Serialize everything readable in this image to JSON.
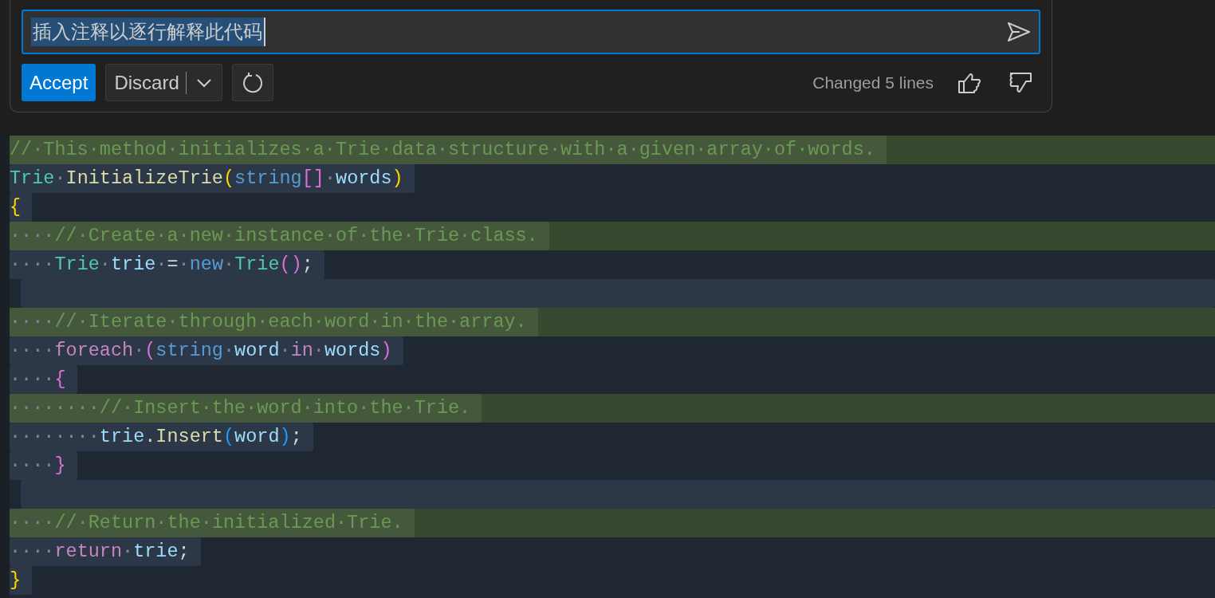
{
  "prompt": {
    "value": "插入注释以逐行解释此代码",
    "text_selected": true
  },
  "actions": {
    "accept": "Accept",
    "discard": "Discard",
    "status": "Changed 5 lines"
  },
  "code_lines": [
    {
      "added": true,
      "tokens": [
        {
          "t": "//·This·method·initializes·a·Trie·data·structure·with·a·given·array·of·words.",
          "kind": "comment"
        }
      ]
    },
    {
      "added": false,
      "tokens": [
        {
          "t": "Trie",
          "kind": "type"
        },
        {
          "t": "·",
          "kind": "ws"
        },
        {
          "t": "InitializeTrie",
          "kind": "method"
        },
        {
          "t": "(",
          "kind": "bracket1"
        },
        {
          "t": "string",
          "kind": "keyword"
        },
        {
          "t": "[]",
          "kind": "bracket2"
        },
        {
          "t": "·",
          "kind": "ws"
        },
        {
          "t": "words",
          "kind": "variable"
        },
        {
          "t": ")",
          "kind": "bracket1"
        }
      ]
    },
    {
      "added": false,
      "tokens": [
        {
          "t": "{",
          "kind": "bracket1"
        }
      ]
    },
    {
      "added": true,
      "tokens": [
        {
          "t": "····",
          "kind": "ws"
        },
        {
          "t": "//·Create·a·new·instance·of·the·Trie·class.",
          "kind": "comment"
        }
      ]
    },
    {
      "added": false,
      "tokens": [
        {
          "t": "····",
          "kind": "ws"
        },
        {
          "t": "Trie",
          "kind": "type"
        },
        {
          "t": "·",
          "kind": "ws"
        },
        {
          "t": "trie",
          "kind": "variable"
        },
        {
          "t": "·",
          "kind": "ws"
        },
        {
          "t": "=",
          "kind": "plain"
        },
        {
          "t": "·",
          "kind": "ws"
        },
        {
          "t": "new",
          "kind": "keyword"
        },
        {
          "t": "·",
          "kind": "ws"
        },
        {
          "t": "Trie",
          "kind": "type"
        },
        {
          "t": "()",
          "kind": "bracket2"
        },
        {
          "t": ";",
          "kind": "plain"
        }
      ]
    },
    {
      "added": false
    },
    {
      "added": true,
      "tokens": [
        {
          "t": "····",
          "kind": "ws"
        },
        {
          "t": "//·Iterate·through·each·word·in·the·array.",
          "kind": "comment"
        }
      ]
    },
    {
      "added": false,
      "tokens": [
        {
          "t": "····",
          "kind": "ws"
        },
        {
          "t": "foreach",
          "kind": "control"
        },
        {
          "t": "·",
          "kind": "ws"
        },
        {
          "t": "(",
          "kind": "bracket2"
        },
        {
          "t": "string",
          "kind": "keyword"
        },
        {
          "t": "·",
          "kind": "ws"
        },
        {
          "t": "word",
          "kind": "variable"
        },
        {
          "t": "·",
          "kind": "ws"
        },
        {
          "t": "in",
          "kind": "control"
        },
        {
          "t": "·",
          "kind": "ws"
        },
        {
          "t": "words",
          "kind": "variable"
        },
        {
          "t": ")",
          "kind": "bracket2"
        }
      ]
    },
    {
      "added": false,
      "tokens": [
        {
          "t": "····",
          "kind": "ws"
        },
        {
          "t": "{",
          "kind": "bracket2"
        }
      ]
    },
    {
      "added": true,
      "tokens": [
        {
          "t": "········",
          "kind": "ws"
        },
        {
          "t": "//·Insert·the·word·into·the·Trie.",
          "kind": "comment"
        }
      ]
    },
    {
      "added": false,
      "tokens": [
        {
          "t": "········",
          "kind": "ws"
        },
        {
          "t": "trie",
          "kind": "variable"
        },
        {
          "t": ".",
          "kind": "plain"
        },
        {
          "t": "Insert",
          "kind": "method"
        },
        {
          "t": "(",
          "kind": "bracket3"
        },
        {
          "t": "word",
          "kind": "variable"
        },
        {
          "t": ")",
          "kind": "bracket3"
        },
        {
          "t": ";",
          "kind": "plain"
        }
      ]
    },
    {
      "added": false,
      "tokens": [
        {
          "t": "····",
          "kind": "ws"
        },
        {
          "t": "}",
          "kind": "bracket2"
        }
      ]
    },
    {
      "added": false
    },
    {
      "added": true,
      "tokens": [
        {
          "t": "····",
          "kind": "ws"
        },
        {
          "t": "//·Return·the·initialized·Trie.",
          "kind": "comment"
        }
      ]
    },
    {
      "added": false,
      "tokens": [
        {
          "t": "····",
          "kind": "ws"
        },
        {
          "t": "return",
          "kind": "control"
        },
        {
          "t": "·",
          "kind": "ws"
        },
        {
          "t": "trie",
          "kind": "variable"
        },
        {
          "t": ";",
          "kind": "plain"
        }
      ]
    },
    {
      "added": false,
      "tokens": [
        {
          "t": "}",
          "kind": "bracket1"
        }
      ]
    }
  ]
}
